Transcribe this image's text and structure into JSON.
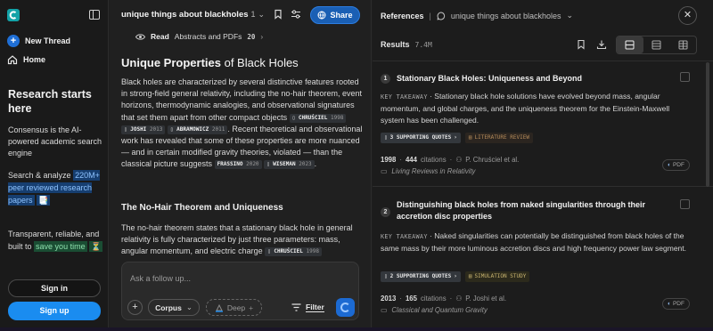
{
  "sidebar": {
    "new_thread": "New Thread",
    "home": "Home",
    "promo_title": "Research starts here",
    "promo_desc": "Consensus is the AI-powered academic search engine",
    "search_prefix": "Search & analyze",
    "search_highlight": "220M+ peer reviewed research papers",
    "search_emoji": "📑",
    "tr_prefix": "Transparent, reliable, and built to",
    "tr_highlight": "save you time",
    "tr_emoji": "⏳",
    "signin": "Sign in",
    "signup": "Sign up"
  },
  "main": {
    "thread_title": "unique things about blackholes",
    "thread_version": "1",
    "share": "Share",
    "read_label": "Read",
    "read_sources": "Abstracts and PDFs",
    "read_count": "20",
    "answer_title_bold": "Unique Properties",
    "answer_title_rest": "of Black Holes",
    "para1": {
      "t1": "Black holes are characterized by several distinctive features rooted in strong-field general relativity, including the no-hair theorem, event horizons, thermodynamic analogies, and observational signatures that set them apart from other compact objects",
      "c1a": "CHRUŚCIEL",
      "c1b": "1998",
      "c2a": "JOSHI",
      "c2b": "2013",
      "c3a": "ABRAMOWICZ",
      "c3b": "2011",
      "t2": ". Recent theoretical and observational work has revealed that some of these properties are more nuanced — and in certain modified gravity theories, violated — than the classical picture suggests",
      "c4a": "FRASSINO",
      "c4b": "2020",
      "c5a": "WISEMAN",
      "c5b": "2023",
      "t3": "."
    },
    "section_heading": "The No-Hair Theorem and Uniqueness",
    "para2": {
      "t1": "The no-hair theorem states that a stationary black hole in general relativity is fully characterized by just three parameters: mass, angular momentum, and electric charge",
      "c1a": "CHRUŚCIEL",
      "c1b": "1998"
    },
    "followup": {
      "placeholder": "Ask a follow up...",
      "corpus": "Corpus",
      "deep": "Deep",
      "filter": "Filter"
    }
  },
  "refs": {
    "title": "References",
    "query": "unique things about blackholes",
    "results_label": "Results",
    "results_count": "7.4M",
    "cards": [
      {
        "num": "1",
        "title": "Stationary Black Holes: Uniqueness and Beyond",
        "key": "KEY TAKEAWAY",
        "takeaway": "Stationary black hole solutions have evolved beyond mass, angular momentum, and global charges, and the uniqueness theorem for the Einstein-Maxwell system has been challenged.",
        "quotes": "3 SUPPORTING QUOTES",
        "type": "LITERATURE REVIEW",
        "year": "1998",
        "citations": "444",
        "citations_label": "citations",
        "authors": "P. Chruściel et al.",
        "journal": "Living Reviews in Relativity",
        "pdf": "PDF"
      },
      {
        "num": "2",
        "title": "Distinguishing black holes from naked singularities through their accretion disc properties",
        "key": "KEY TAKEAWAY",
        "takeaway": "Naked singularities can potentially be distinguished from black holes of the same mass by their more luminous accretion discs and high frequency power law segment.",
        "quotes": "2 SUPPORTING QUOTES",
        "type": "SIMULATION STUDY",
        "year": "2013",
        "citations": "165",
        "citations_label": "citations",
        "authors": "P. Joshi et al.",
        "journal": "Classical and Quantum Gravity",
        "pdf": "PDF"
      }
    ]
  },
  "colors": {
    "accent": "#1a8cf0",
    "share_bg": "#1a5fb4",
    "highlight_blue": "#163e70",
    "highlight_green": "#1a4d33",
    "literature_review": "#b48b5a",
    "simulation_study": "#c9b470"
  }
}
